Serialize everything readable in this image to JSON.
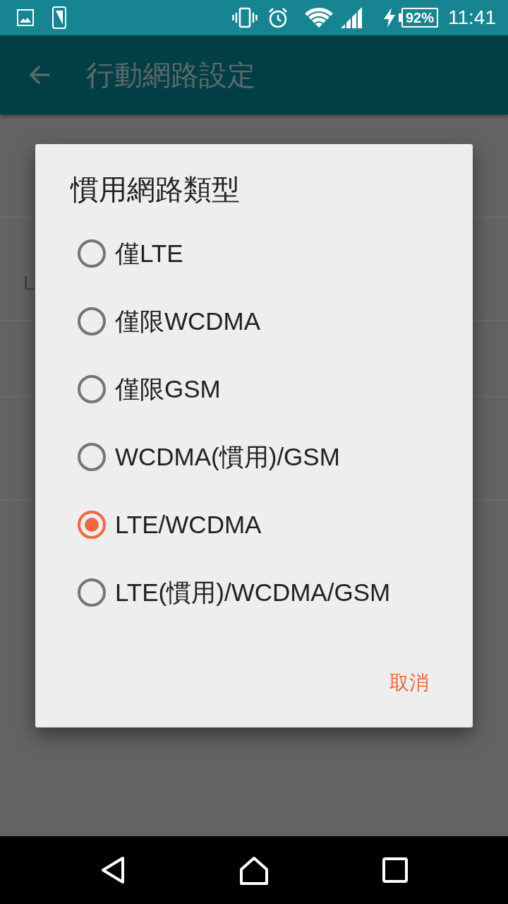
{
  "status_bar": {
    "battery": "92%",
    "time": "11:41"
  },
  "app_bar": {
    "title": "行動網路設定"
  },
  "settings_list": [
    {
      "kind": "two_line"
    },
    {
      "kind": "two_line",
      "subtitle": "L"
    },
    {
      "kind": "one_line"
    },
    {
      "kind": "two_line"
    }
  ],
  "dialog": {
    "title": "慣用網路類型",
    "options": [
      {
        "label": "僅LTE",
        "selected": false
      },
      {
        "label": "僅限WCDMA",
        "selected": false
      },
      {
        "label": "僅限GSM",
        "selected": false
      },
      {
        "label": "WCDMA(慣用)/GSM",
        "selected": false
      },
      {
        "label": "LTE/WCDMA",
        "selected": true
      },
      {
        "label": "LTE(慣用)/WCDMA/GSM",
        "selected": false
      }
    ],
    "buttons": [
      "取消"
    ]
  }
}
